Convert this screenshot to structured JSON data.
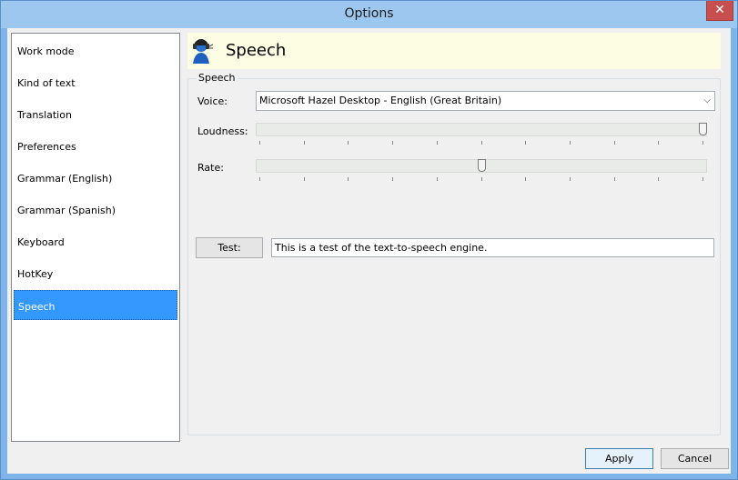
{
  "window": {
    "title": "Options",
    "close_glyph": "✕"
  },
  "sidebar": {
    "items": [
      {
        "label": "Work mode"
      },
      {
        "label": "Kind of text"
      },
      {
        "label": "Translation"
      },
      {
        "label": "Preferences"
      },
      {
        "label": "Grammar (English)"
      },
      {
        "label": "Grammar (Spanish)"
      },
      {
        "label": "Keyboard"
      },
      {
        "label": "HotKey"
      },
      {
        "label": "Speech",
        "selected": true
      }
    ]
  },
  "header": {
    "title": "Speech",
    "icon": "speaker-person-icon"
  },
  "group": {
    "title": "Speech"
  },
  "voice": {
    "label": "Voice:",
    "value": "Microsoft Hazel Desktop - English (Great Britain)"
  },
  "loudness": {
    "label": "Loudness:",
    "value_fraction": 1.0
  },
  "rate": {
    "label": "Rate:",
    "value_fraction": 0.5
  },
  "test": {
    "button_label": "Test:",
    "text": "This is a test of the text-to-speech engine."
  },
  "footer": {
    "apply_label": "Apply",
    "cancel_label": "Cancel"
  },
  "colors": {
    "selection": "#3399ff",
    "header_bg": "#fdfde3",
    "titlebar": "#9ec7f0",
    "close": "#c7504f"
  }
}
